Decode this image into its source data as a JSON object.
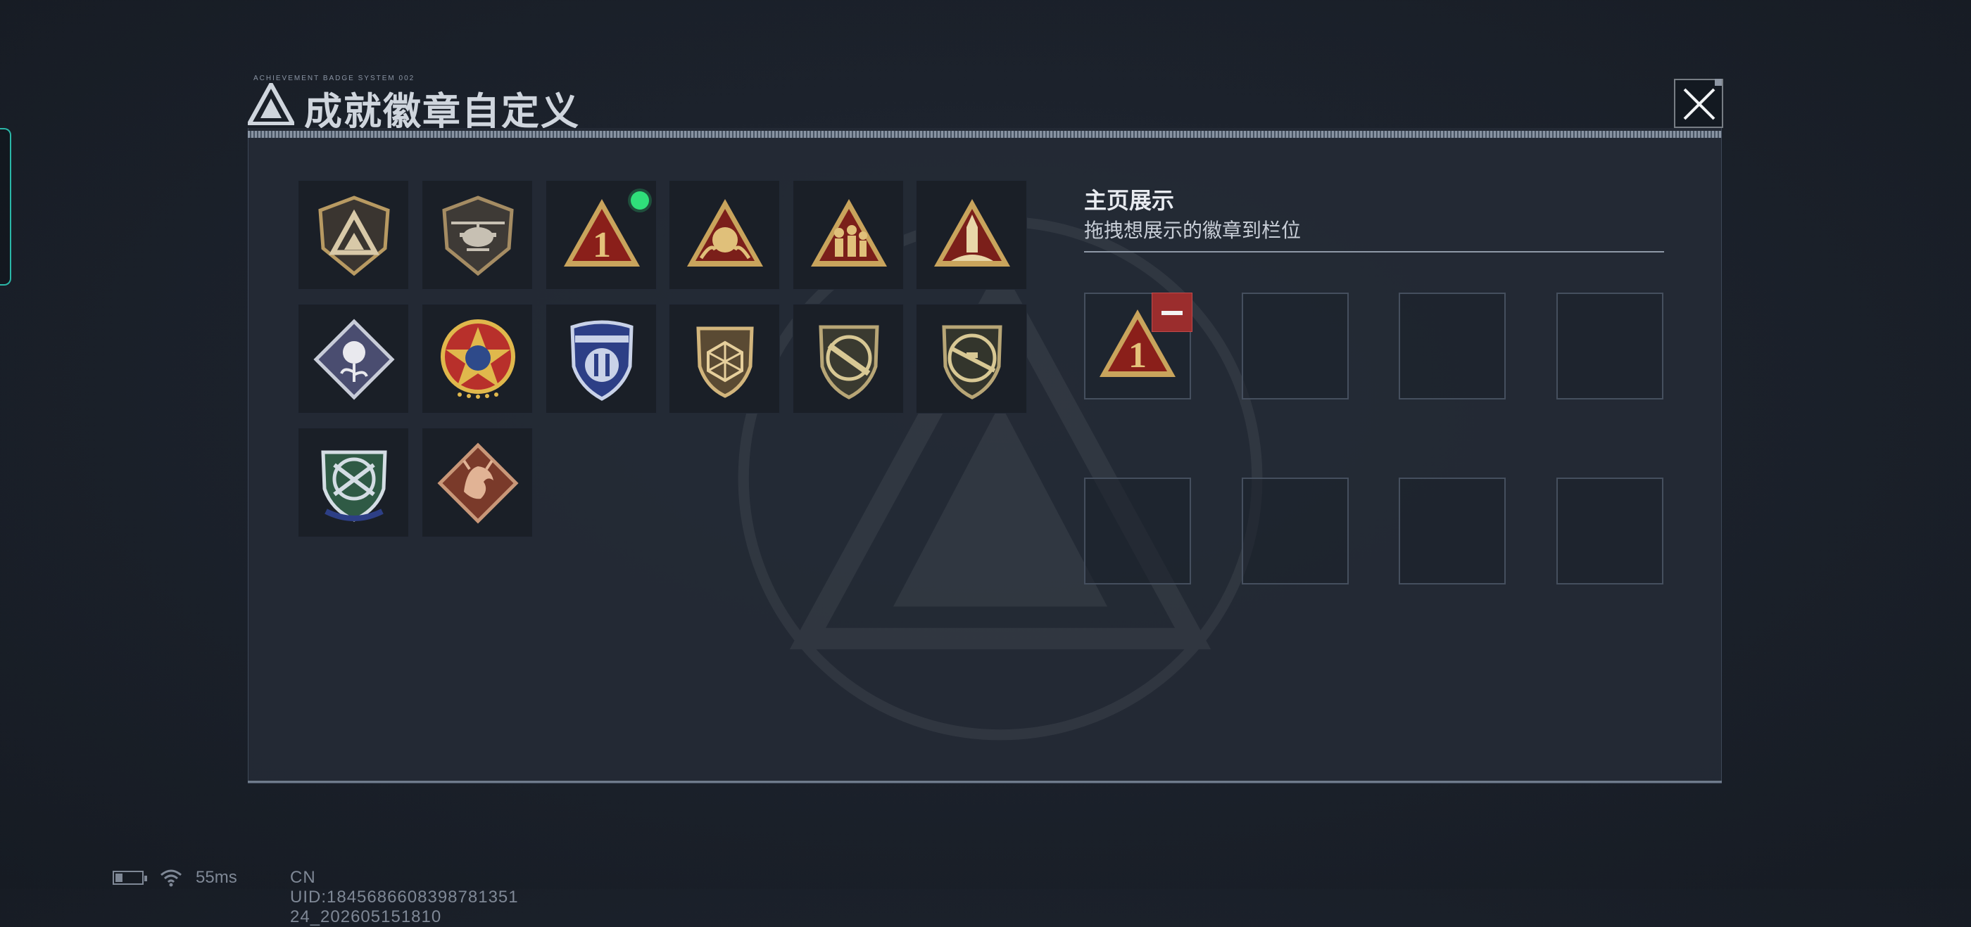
{
  "dialog": {
    "title": "成就徽章自定义",
    "title_decoration": "ACHIEVEMENT BADGE SYSTEM 002",
    "close_icon": "close-icon"
  },
  "badges": [
    {
      "icon": "delta-triangle-shield-badge",
      "new": false
    },
    {
      "icon": "helicopter-badge",
      "new": false
    },
    {
      "icon": "number-one-triangle-badge",
      "new": true
    },
    {
      "icon": "sphere-hands-triangle-badge",
      "new": false
    },
    {
      "icon": "soldiers-triangle-badge",
      "new": false
    },
    {
      "icon": "rocket-triangle-badge",
      "new": false
    },
    {
      "icon": "rose-diamond-badge",
      "new": false
    },
    {
      "icon": "star-medal-badge",
      "new": false
    },
    {
      "icon": "blue-shield-badge",
      "new": false
    },
    {
      "icon": "polyhedron-shield-badge",
      "new": false
    },
    {
      "icon": "rifle-shield-badge",
      "new": false
    },
    {
      "icon": "sniper-shield-badge",
      "new": false
    },
    {
      "icon": "green-crossed-rifles-badge",
      "new": false
    },
    {
      "icon": "dragon-diamond-badge",
      "new": false
    }
  ],
  "showcase": {
    "title": "主页展示",
    "subtitle": "拖拽想展示的徽章到栏位",
    "slots": [
      {
        "badge": "number-one-triangle-badge"
      },
      {
        "badge": null
      },
      {
        "badge": null
      },
      {
        "badge": null
      },
      {
        "badge": null
      },
      {
        "badge": null
      },
      {
        "badge": null
      },
      {
        "badge": null
      }
    ],
    "remove_icon": "minus-icon"
  },
  "status": {
    "ping": "55ms",
    "uid": "CN UID:1845686608398781351 24_202605151810"
  },
  "colors": {
    "accent_green": "#2fe07a",
    "remove_red": "#9b2d2d",
    "gold": "#c9a45c",
    "badge_red": "#8a1f1a"
  }
}
